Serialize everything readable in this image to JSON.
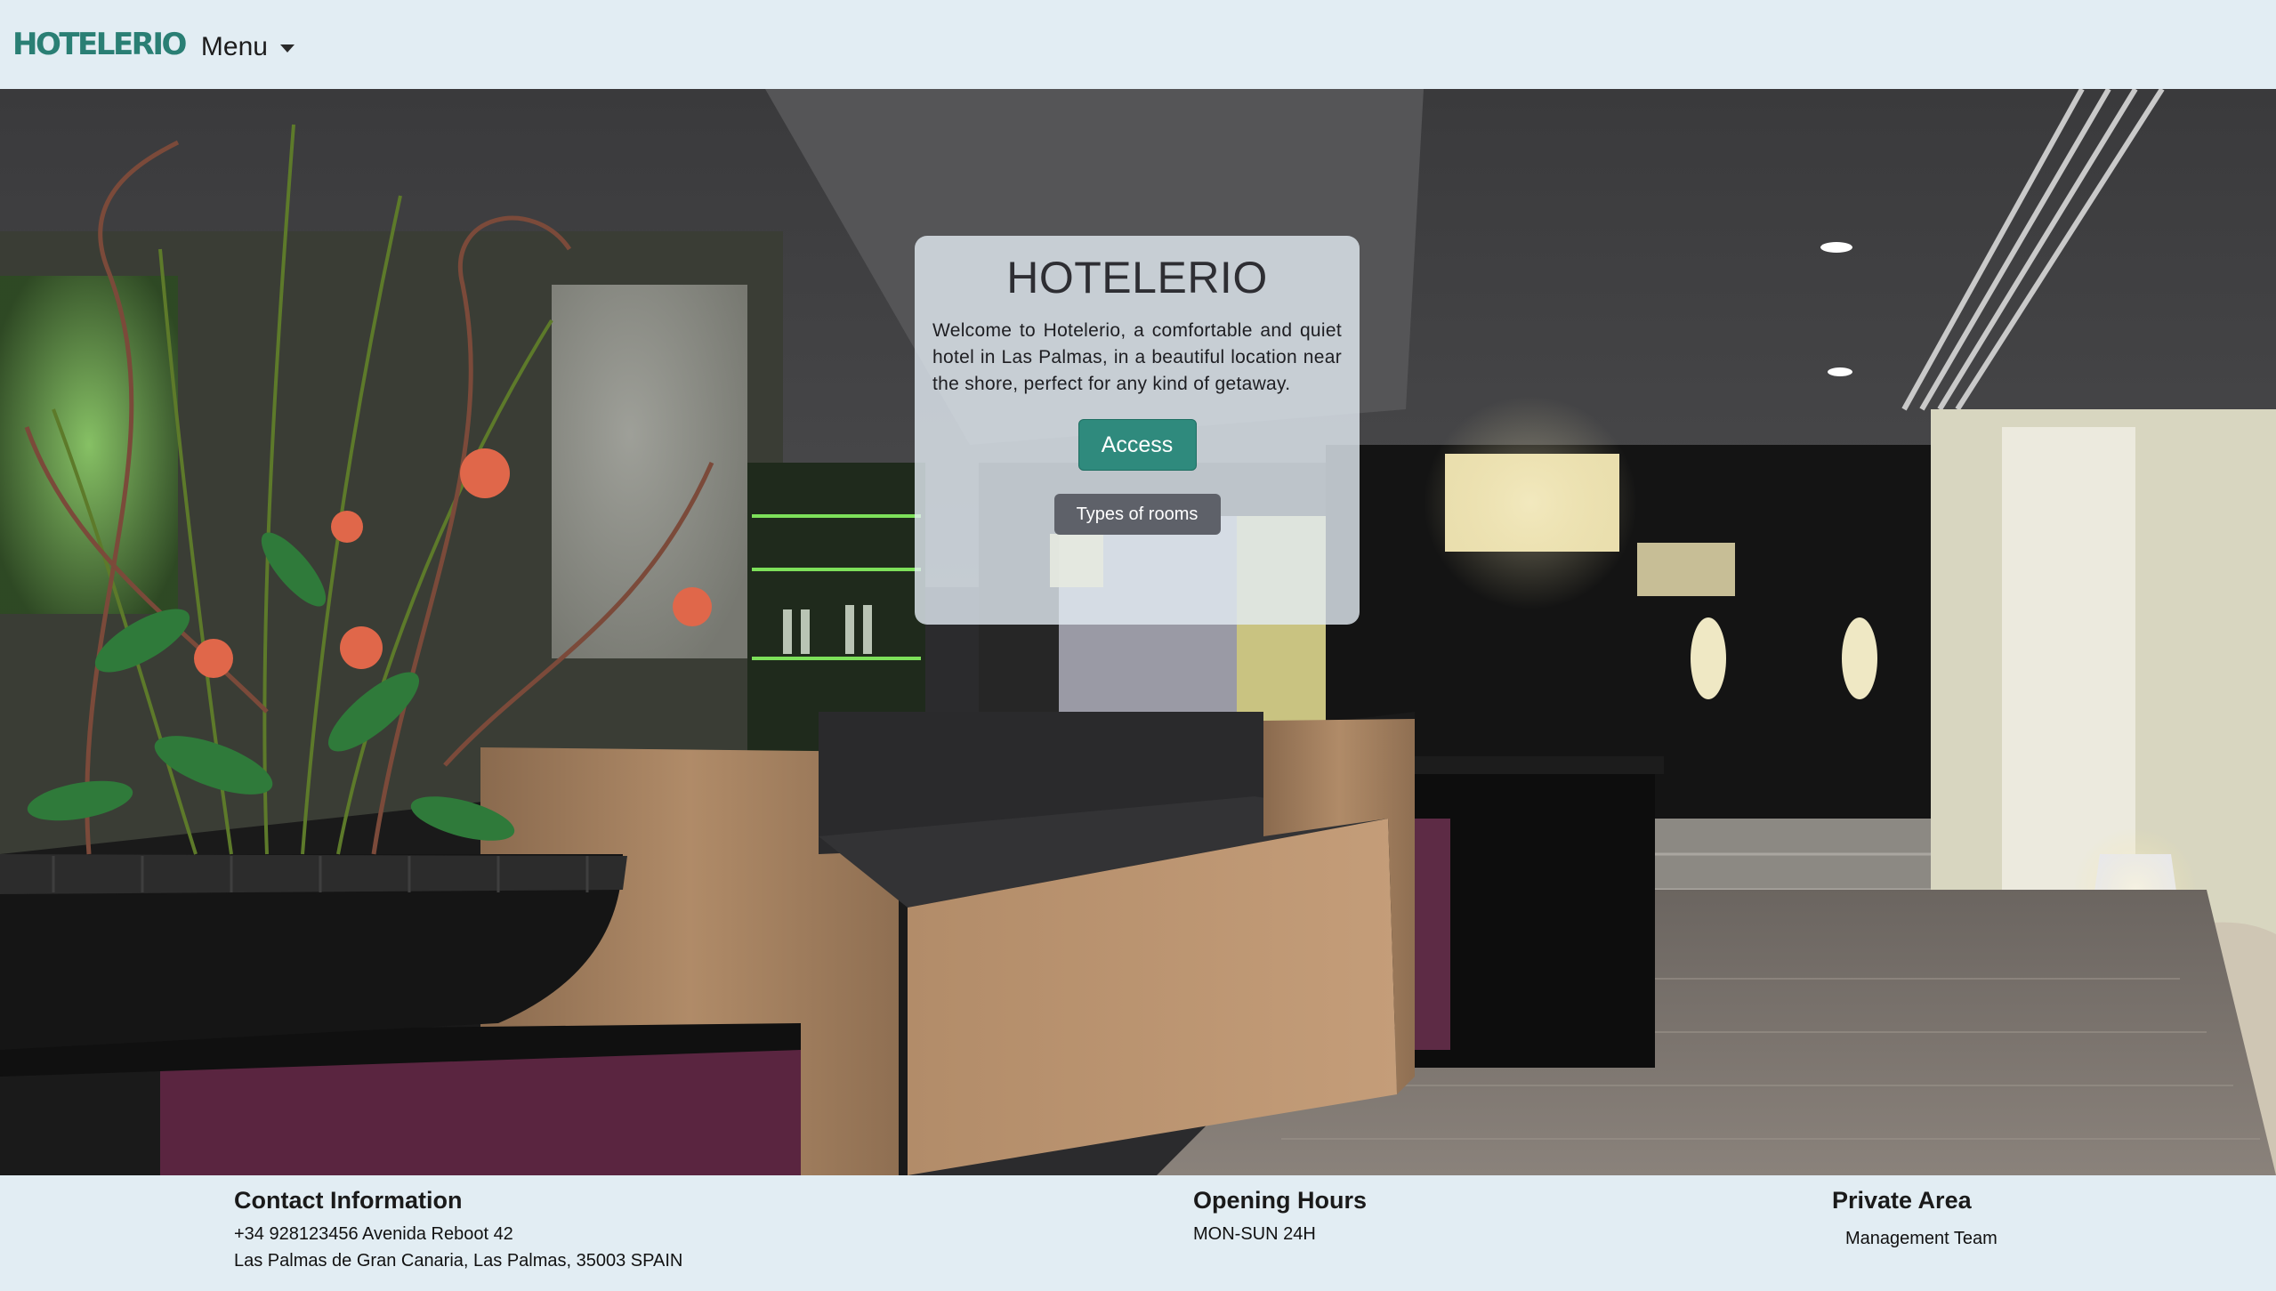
{
  "navbar": {
    "brand": "HOTELERIO",
    "menu_label": "Menu"
  },
  "hero": {
    "image_alt": "Hotel lobby with reception desk and flower arrangement"
  },
  "welcome_card": {
    "title": "HOTELERIO",
    "description": "Welcome to Hotelerio, a comfortable and quiet hotel in Las Palmas, in a beautiful location near the shore, perfect for any kind of getaway.",
    "access_button": "Access",
    "rooms_button": "Types of rooms"
  },
  "footer": {
    "contact": {
      "title": "Contact Information",
      "phone_address": "+34 928123456 Avenida Reboot 42",
      "city": "Las Palmas de Gran Canaria, Las Palmas, 35003 SPAIN"
    },
    "hours": {
      "title": "Opening Hours",
      "schedule": "MON-SUN 24H"
    },
    "private": {
      "title": "Private Area",
      "link": "Management Team"
    }
  },
  "colors": {
    "brand": "#2a7f74",
    "nav_bg": "#e2edf3",
    "access_button": "#2f8a7d",
    "rooms_button": "#5e6169"
  }
}
